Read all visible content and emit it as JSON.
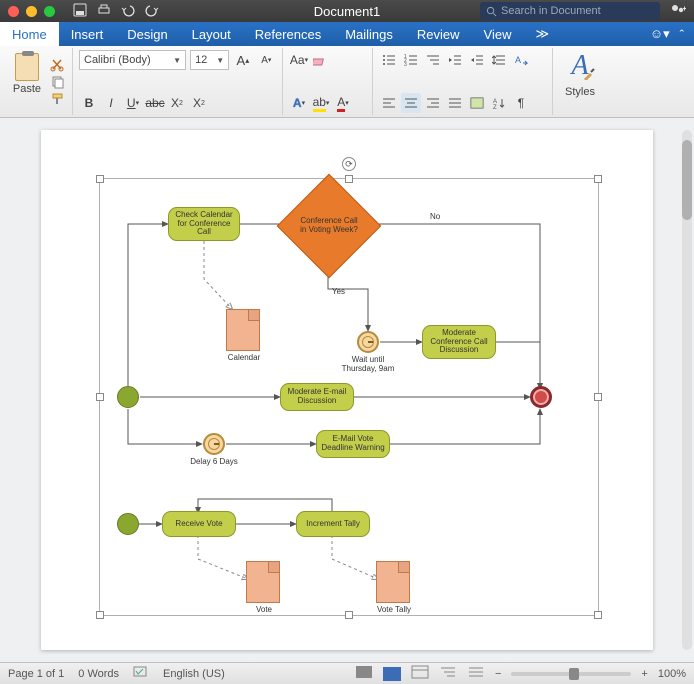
{
  "titlebar": {
    "document_title": "Document1",
    "search_placeholder": "Search in Document"
  },
  "tabs": {
    "items": [
      "Home",
      "Insert",
      "Design",
      "Layout",
      "References",
      "Mailings",
      "Review",
      "View"
    ],
    "active_index": 0
  },
  "ribbon": {
    "paste_label": "Paste",
    "font_name": "Calibri (Body)",
    "font_size": "12",
    "styles_label": "Styles"
  },
  "status": {
    "page": "Page 1 of 1",
    "words": "0 Words",
    "language": "English (US)",
    "zoom": "100%"
  },
  "diagram": {
    "tasks": {
      "t1": "Check Calendar for Conference Call",
      "t2": "Moderate Conference Call Discussion",
      "t3": "Moderate E-mail Discussion",
      "t4": "E-Mail Vote Deadline Warning",
      "t5": "Receive Vote",
      "t6": "Increment Tally"
    },
    "decision": "Conference Call in Voting Week?",
    "edge_yes": "Yes",
    "edge_no": "No",
    "timer1_caption": "Wait until Thursday, 9am",
    "timer2_caption": "Delay 6 Days",
    "doc1_caption": "Calendar",
    "doc2_caption": "Vote",
    "doc3_caption": "Vote Tally"
  }
}
